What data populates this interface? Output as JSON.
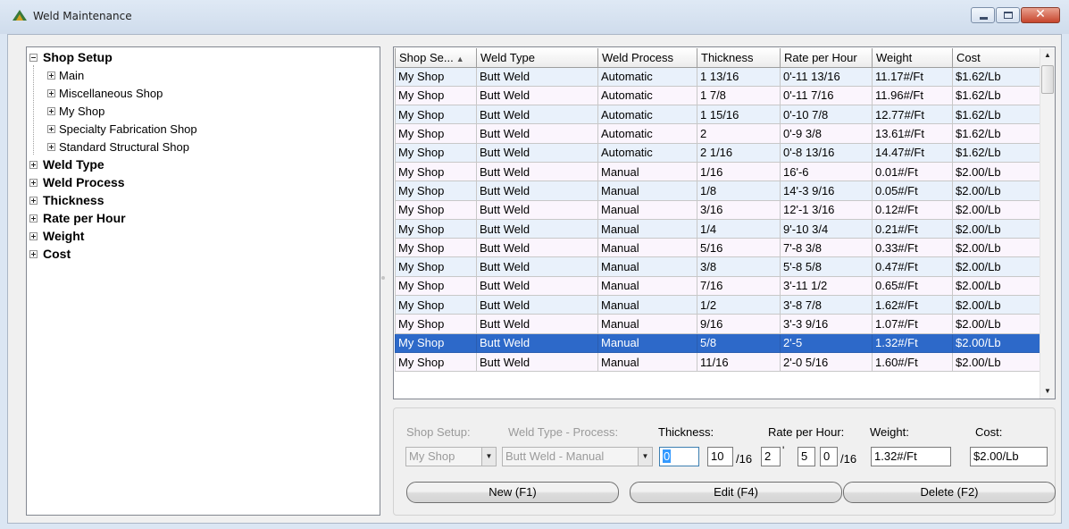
{
  "window": {
    "title": "Weld Maintenance",
    "icon": "app-triangle-icon"
  },
  "tree": {
    "nodes": [
      {
        "label": "Shop Setup",
        "expanded": true,
        "children": [
          {
            "label": "Main"
          },
          {
            "label": "Miscellaneous Shop"
          },
          {
            "label": "My Shop"
          },
          {
            "label": "Specialty Fabrication Shop"
          },
          {
            "label": "Standard Structural Shop"
          }
        ]
      },
      {
        "label": "Weld Type"
      },
      {
        "label": "Weld Process"
      },
      {
        "label": "Thickness"
      },
      {
        "label": "Rate per Hour"
      },
      {
        "label": "Weight"
      },
      {
        "label": "Cost"
      }
    ]
  },
  "grid": {
    "columns": [
      "Shop Se...",
      "Weld Type",
      "Weld Process",
      "Thickness",
      "Rate per Hour",
      "Weight",
      "Cost"
    ],
    "sorted_column": 0,
    "sort_direction": "ascending",
    "selected_row": 14,
    "rows": [
      [
        "My Shop",
        "Butt Weld",
        "Automatic",
        "1 13/16",
        "0'-11 13/16",
        "11.17#/Ft",
        "$1.62/Lb"
      ],
      [
        "My Shop",
        "Butt Weld",
        "Automatic",
        "1 7/8",
        "0'-11 7/16",
        "11.96#/Ft",
        "$1.62/Lb"
      ],
      [
        "My Shop",
        "Butt Weld",
        "Automatic",
        "1 15/16",
        "0'-10 7/8",
        "12.77#/Ft",
        "$1.62/Lb"
      ],
      [
        "My Shop",
        "Butt Weld",
        "Automatic",
        "2",
        "0'-9 3/8",
        "13.61#/Ft",
        "$1.62/Lb"
      ],
      [
        "My Shop",
        "Butt Weld",
        "Automatic",
        "2 1/16",
        "0'-8 13/16",
        "14.47#/Ft",
        "$1.62/Lb"
      ],
      [
        "My Shop",
        "Butt Weld",
        "Manual",
        "1/16",
        "16'-6",
        "0.01#/Ft",
        "$2.00/Lb"
      ],
      [
        "My Shop",
        "Butt Weld",
        "Manual",
        "1/8",
        "14'-3 9/16",
        "0.05#/Ft",
        "$2.00/Lb"
      ],
      [
        "My Shop",
        "Butt Weld",
        "Manual",
        "3/16",
        "12'-1 3/16",
        "0.12#/Ft",
        "$2.00/Lb"
      ],
      [
        "My Shop",
        "Butt Weld",
        "Manual",
        "1/4",
        "9'-10 3/4",
        "0.21#/Ft",
        "$2.00/Lb"
      ],
      [
        "My Shop",
        "Butt Weld",
        "Manual",
        "5/16",
        "7'-8 3/8",
        "0.33#/Ft",
        "$2.00/Lb"
      ],
      [
        "My Shop",
        "Butt Weld",
        "Manual",
        "3/8",
        "5'-8 5/8",
        "0.47#/Ft",
        "$2.00/Lb"
      ],
      [
        "My Shop",
        "Butt Weld",
        "Manual",
        "7/16",
        "3'-11 1/2",
        "0.65#/Ft",
        "$2.00/Lb"
      ],
      [
        "My Shop",
        "Butt Weld",
        "Manual",
        "1/2",
        "3'-8 7/8",
        "1.62#/Ft",
        "$2.00/Lb"
      ],
      [
        "My Shop",
        "Butt Weld",
        "Manual",
        "9/16",
        "3'-3 9/16",
        "1.07#/Ft",
        "$2.00/Lb"
      ],
      [
        "My Shop",
        "Butt Weld",
        "Manual",
        "5/8",
        "2'-5",
        "1.32#/Ft",
        "$2.00/Lb"
      ],
      [
        "My Shop",
        "Butt Weld",
        "Manual",
        "11/16",
        "2'-0 5/16",
        "1.60#/Ft",
        "$2.00/Lb"
      ]
    ]
  },
  "editor": {
    "shop_setup_label": "Shop Setup:",
    "shop_setup_value": "My Shop",
    "weld_type_label": "Weld Type - Process:",
    "weld_type_value": "Butt Weld - Manual",
    "thickness_label": "Thickness:",
    "thickness_whole": "0",
    "thickness_num": "10",
    "thickness_denom": "/16",
    "rate_label": "Rate per Hour:",
    "rate_feet": "2",
    "rate_feet_mark": "'",
    "rate_inches": "5",
    "rate_frac": "0",
    "rate_denom": "/16",
    "weight_label": "Weight:",
    "weight_value": "1.32#/Ft",
    "cost_label": "Cost:",
    "cost_value": "$2.00/Lb",
    "new_button": "New (F1)",
    "edit_button": "Edit (F4)",
    "delete_button": "Delete (F2)"
  },
  "colors": {
    "selected_row": "#2d69c9",
    "row_odd": "#e9f1fb",
    "row_even": "#fbf5fd",
    "close_button": "#c7452c"
  }
}
